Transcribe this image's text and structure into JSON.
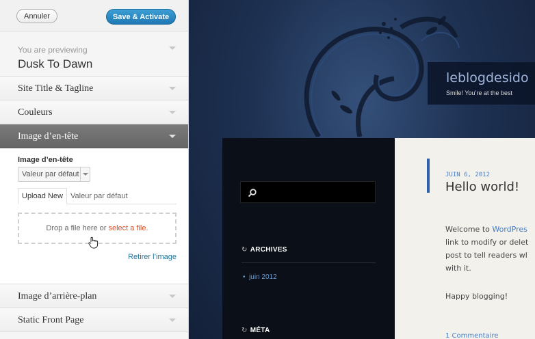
{
  "topbar": {
    "cancel_label": "Annuler",
    "save_label": "Save & Activate"
  },
  "preview_info": {
    "label": "You are previewing",
    "theme": "Dusk To Dawn"
  },
  "sections": {
    "site_title": "Site Title & Tagline",
    "colors": "Couleurs",
    "header_image": "Image d’en-tête",
    "background_image": "Image d’arrière-plan",
    "static_front_page": "Static Front Page"
  },
  "header_panel": {
    "title": "Image d’en-tête",
    "select_value": "Valeur par défaut",
    "tabs": [
      "Upload New",
      "Valeur par défaut"
    ],
    "drop_text": "Drop a file here or",
    "select_link": "select a file.",
    "remove_link": "Retirer l’image"
  },
  "site": {
    "title": "leblogdesido",
    "description": "Smile! You’re at the best"
  },
  "widgets": {
    "archives_title": "ARCHIVES",
    "archives_item": "juin 2012",
    "meta_title": "MÉTA"
  },
  "post": {
    "date": "JUIN 6, 2012",
    "title": "Hello world!",
    "body_prefix": "Welcome to",
    "body_link": "WordPres",
    "line2": "link to modify or delet",
    "line3": "post to tell readers wl",
    "line4": "with it.",
    "happy": "Happy blogging!",
    "comments": "1 Commentaire"
  },
  "colors": {
    "accent": "#1f78b4",
    "link": "#21759b",
    "active_section": "#6e6e6e"
  }
}
